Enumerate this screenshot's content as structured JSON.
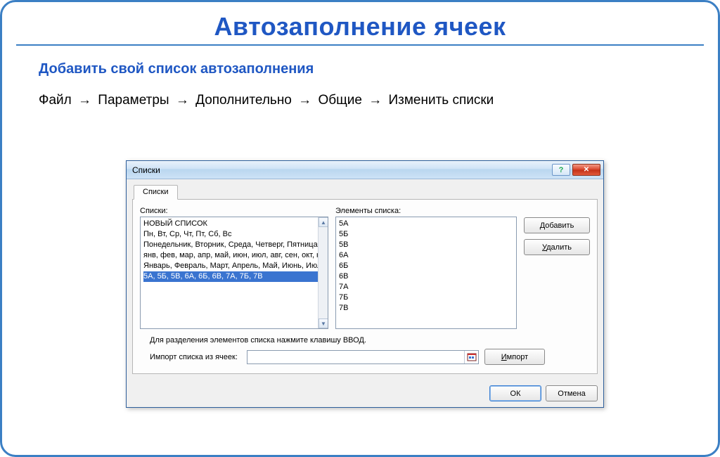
{
  "page": {
    "title": "Автозаполнение ячеек",
    "subtitle": "Добавить свой список автозаполнения",
    "path": [
      "Файл",
      "Параметры",
      "Дополнительно",
      "Общие",
      "Изменить списки"
    ]
  },
  "dialog": {
    "title": "Списки",
    "help_symbol": "?",
    "close_symbol": "✕",
    "tab_label": "Списки",
    "lists_label": "Списки:",
    "lists_items": [
      "НОВЫЙ СПИСОК",
      "Пн, Вт, Ср, Чт, Пт, Сб, Вс",
      "Понедельник, Вторник, Среда, Четверг, Пятница,",
      "янв, фев, мар, апр, май, июн, июл, авг, сен, окт, но",
      "Январь, Февраль, Март, Апрель, Май, Июнь, Июль",
      "5А, 5Б, 5В, 6А, 6Б, 6В, 7А, 7Б, 7В"
    ],
    "lists_selected_index": 5,
    "elements_label": "Элементы списка:",
    "elements_items": [
      "5А",
      "5Б",
      "5В",
      "6А",
      "6Б",
      "6В",
      "7А",
      "7Б",
      "7В"
    ],
    "btn_add": "Добавить",
    "btn_delete": "Удалить",
    "hint": "Для разделения элементов списка нажмите клавишу ВВОД.",
    "import_label": "Импорт списка из ячеек:",
    "btn_import": "Импорт",
    "btn_ok": "ОК",
    "btn_cancel": "Отмена"
  }
}
